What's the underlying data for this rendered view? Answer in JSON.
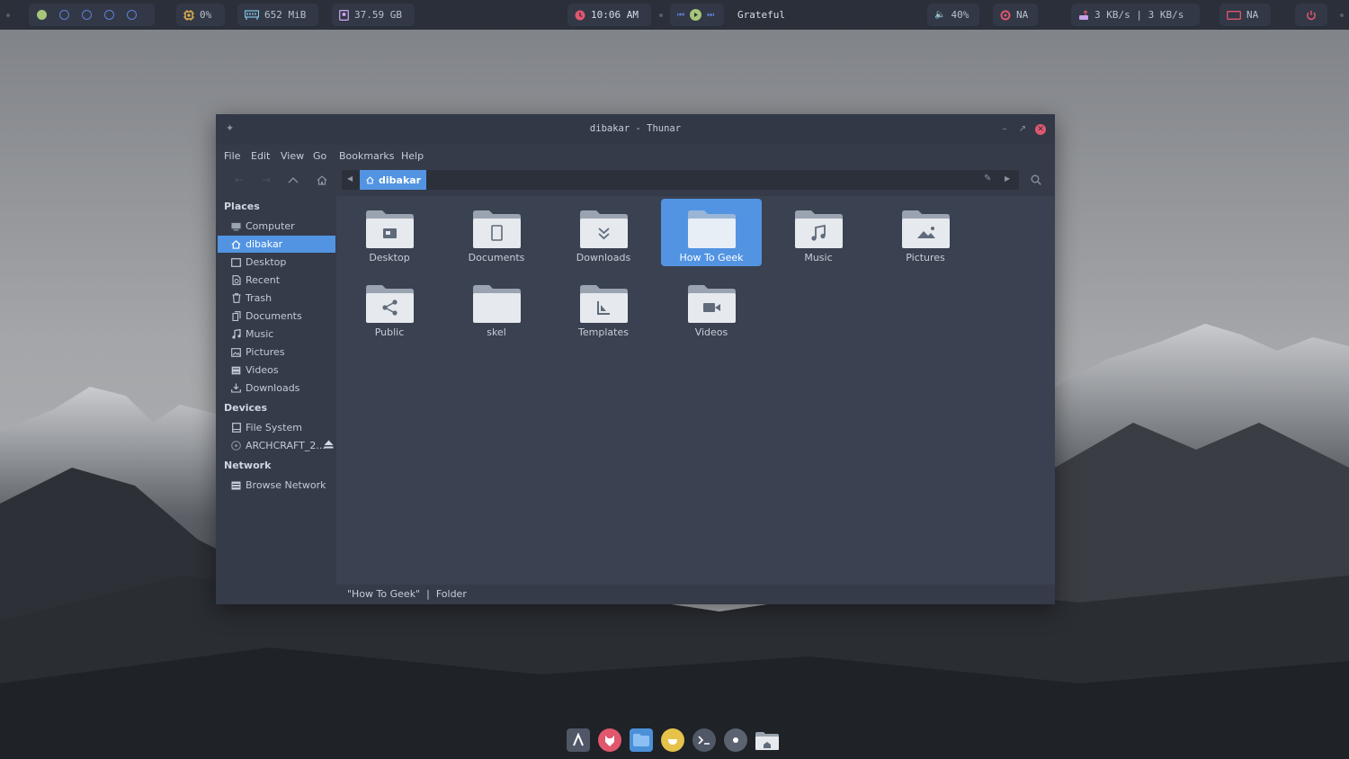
{
  "topbar": {
    "workspaces": [
      "1",
      "2",
      "3",
      "4",
      "5"
    ],
    "cpu": "0%",
    "memory": "652 MiB",
    "disk": "37.59 GB",
    "time": "10:06 AM",
    "now_playing": "Grateful",
    "volume": "40%",
    "battery": "NA",
    "network_speed": "3 KB/s | 3 KB/s",
    "brightness": "NA",
    "colors": {
      "active_workspace": "#a6c57a",
      "workspace": "#5e81d8",
      "accent_red": "#e0576e",
      "cpu_icon": "#e6b450",
      "mem_icon": "#7ec8e3"
    }
  },
  "window": {
    "title": "dibakar - Thunar",
    "menu": [
      "File",
      "Edit",
      "View",
      "Go",
      "Bookmarks",
      "Help"
    ],
    "path": "dibakar",
    "accent": "#5294e2"
  },
  "sidebar": {
    "places_heading": "Places",
    "places": [
      {
        "label": "Computer",
        "icon": "computer-icon"
      },
      {
        "label": "dibakar",
        "icon": "home-icon",
        "selected": true
      },
      {
        "label": "Desktop",
        "icon": "desktop-icon"
      },
      {
        "label": "Recent",
        "icon": "recent-icon"
      },
      {
        "label": "Trash",
        "icon": "trash-icon"
      },
      {
        "label": "Documents",
        "icon": "documents-icon"
      },
      {
        "label": "Music",
        "icon": "music-icon"
      },
      {
        "label": "Pictures",
        "icon": "pictures-icon"
      },
      {
        "label": "Videos",
        "icon": "videos-icon"
      },
      {
        "label": "Downloads",
        "icon": "downloads-icon"
      }
    ],
    "devices_heading": "Devices",
    "devices": [
      {
        "label": "File System",
        "icon": "drive-icon"
      },
      {
        "label": "ARCHCRAFT_2...",
        "icon": "disc-icon"
      }
    ],
    "network_heading": "Network",
    "network": [
      {
        "label": "Browse Network",
        "icon": "network-icon"
      }
    ]
  },
  "folders": [
    {
      "label": "Desktop",
      "emblem": "desktop"
    },
    {
      "label": "Documents",
      "emblem": "documents"
    },
    {
      "label": "Downloads",
      "emblem": "downloads"
    },
    {
      "label": "How To Geek",
      "emblem": "none",
      "selected": true
    },
    {
      "label": "Music",
      "emblem": "music"
    },
    {
      "label": "Pictures",
      "emblem": "pictures"
    },
    {
      "label": "Public",
      "emblem": "share"
    },
    {
      "label": "skel",
      "emblem": "none"
    },
    {
      "label": "Templates",
      "emblem": "templates"
    },
    {
      "label": "Videos",
      "emblem": "videos"
    }
  ],
  "status": {
    "name": "\"How To Geek\"",
    "separator": "|",
    "type": "Folder"
  },
  "dock": [
    "archcraft-icon",
    "firefox-icon",
    "files-icon",
    "editor-icon",
    "terminal-icon",
    "settings-icon",
    "home-folder-icon"
  ]
}
